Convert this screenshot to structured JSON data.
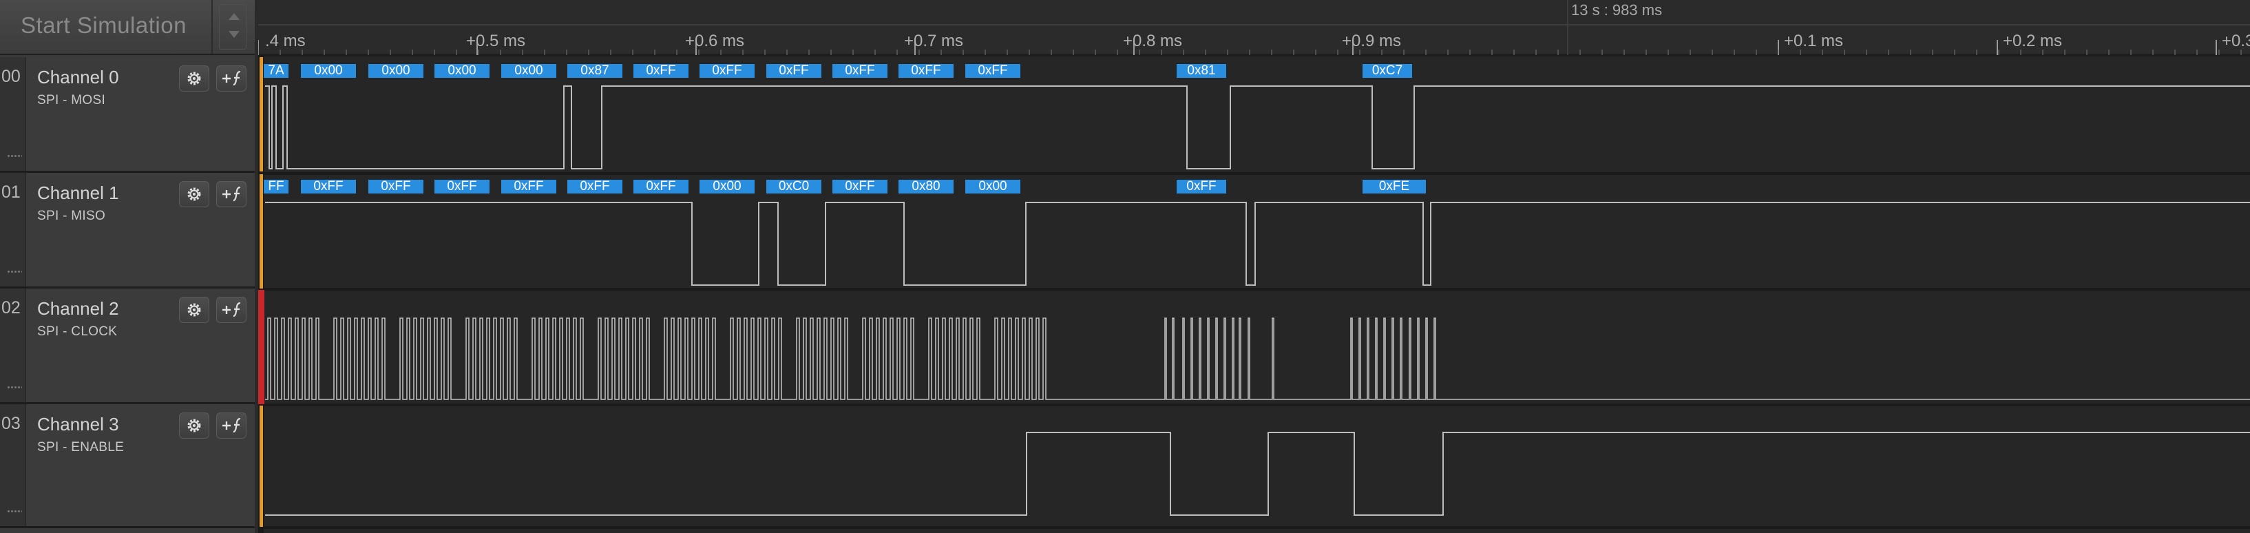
{
  "toolbar": {
    "start_label": "Start Simulation"
  },
  "ruler": {
    "title": "13 s : 983 ms",
    "ticks": [
      ".4 ms",
      "+0.5 ms",
      "+0.6 ms",
      "+0.7 ms",
      "+0.8 ms",
      "+0.9 ms",
      "+0.1 ms",
      "+0.2 ms",
      "+0.3"
    ]
  },
  "colors": {
    "accent": "#2a8ee0",
    "trace": "#bdbdbd",
    "cursor_red": "#c8282c",
    "cursor_orange": "#e39a2b"
  },
  "channels": [
    {
      "index": "00",
      "name": "Channel 0",
      "desc": "SPI - MOSI",
      "bytes": [
        "7A",
        "0x00",
        "0x00",
        "0x00",
        "0x00",
        "0x87",
        "0xFF",
        "0xFF",
        "0xFF",
        "0xFF",
        "0xFF",
        "0xFF",
        "0x81",
        "0xC7"
      ]
    },
    {
      "index": "01",
      "name": "Channel 1",
      "desc": "SPI - MISO",
      "bytes": [
        "FF",
        "0xFF",
        "0xFF",
        "0xFF",
        "0xFF",
        "0xFF",
        "0xFF",
        "0x00",
        "0xC0",
        "0xFF",
        "0x80",
        "0x00",
        "0xFF",
        "0xFE"
      ]
    },
    {
      "index": "02",
      "name": "Channel 2",
      "desc": "SPI - CLOCK",
      "bytes": []
    },
    {
      "index": "03",
      "name": "Channel 3",
      "desc": "SPI - ENABLE",
      "bytes": []
    }
  ],
  "icons": {
    "settings": "gear-icon",
    "function": "add-function-icon"
  }
}
